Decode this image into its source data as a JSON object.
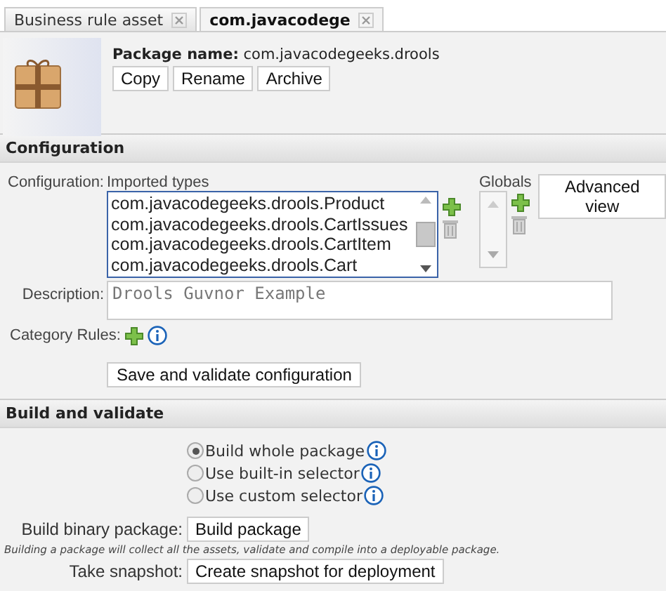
{
  "tabs": [
    {
      "label": "Business rule asset",
      "selected": false
    },
    {
      "label": "com.javacodege",
      "selected": true
    }
  ],
  "package": {
    "name_label": "Package name:",
    "name": "com.javacodegeeks.drools",
    "buttons": [
      "Copy",
      "Rename",
      "Archive"
    ]
  },
  "configuration": {
    "title": "Configuration",
    "config_label": "Configuration:",
    "imported_types_label": "Imported types",
    "imported_types": [
      {
        "label": "com.javacodegeeks.drools.Product",
        "selected": false
      },
      {
        "label": "com.javacodegeeks.drools.CartIssues",
        "selected": false
      },
      {
        "label": "com.javacodegeeks.drools.CartItem",
        "selected": false
      },
      {
        "label": "com.javacodegeeks.drools.Cart",
        "selected": false
      }
    ],
    "globals_label": "Globals",
    "advanced_view": "Advanced view",
    "description_label": "Description:",
    "description": "Drools Guvnor Example",
    "category_rules_label": "Category Rules:",
    "save_button": "Save and validate configuration"
  },
  "build": {
    "title": "Build and validate",
    "options": [
      {
        "label": "Build whole package",
        "selected": true
      },
      {
        "label": "Use built-in selector",
        "selected": false
      },
      {
        "label": "Use custom selector",
        "selected": false
      }
    ],
    "build_binary_label": "Build binary package:",
    "build_button": "Build package",
    "note": "Building a package will collect all the assets, validate and compile into a deployable package.",
    "snapshot_label": "Take snapshot:",
    "snapshot_button": "Create snapshot for deployment"
  }
}
